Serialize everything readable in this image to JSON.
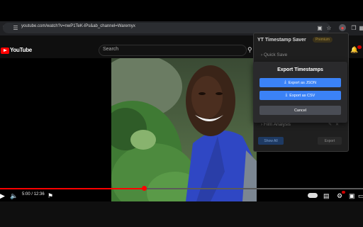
{
  "browser": {
    "url": "youtube.com/watch?v=nwP1TeK-lPs&ab_channel=Waremyx"
  },
  "youtube": {
    "logo_text": "YouTube",
    "search_placeholder": "Search"
  },
  "player": {
    "current_time": "5:00",
    "separator": "/",
    "duration": "12:36",
    "progress_fraction": 0.397
  },
  "extension": {
    "title": "YT Timestamp Saver",
    "badge": "Premium",
    "section_quick_save": "Quick Save",
    "section_film_analysis": "Film Analysis",
    "bottom_left_label": "Show All",
    "bottom_right_label": "Export"
  },
  "dialog": {
    "title": "Export Timestamps",
    "json_button": "Export as JSON",
    "csv_button": "Export as CSV",
    "cancel_button": "Cancel",
    "primary_color": "#3b82f6",
    "cancel_color": "#4a4d55"
  }
}
